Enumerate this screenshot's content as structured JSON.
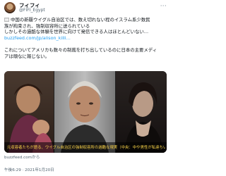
{
  "account": {
    "display_name": "フィフィ",
    "handle": "@FIFI_Egypt"
  },
  "tweet": {
    "line1": "中国の新疆ウイグル自治区では、数え切れない程のイスラム系少数民",
    "line2": "族が拘束され、強制収容所に送られている",
    "line3": "しかしその過酷な体験を世界に向けて発信できる人はほとんどいない…",
    "link": "buzzfeed.com/jp/alison_killi…",
    "line4": "これについてアメリカも数々の制裁を打ち出しているのに日本の主要メディ",
    "line5": "アは頑なに報じない。"
  },
  "media": {
    "caption": "元収容者たちが語る、ウイグル自治区の強制収容所の過酷な現実（中央：中や男性が私達ちいる…"
  },
  "card_source": "buzzfeed.comから",
  "timestamp": "午後6:29 · 2021年1月20日",
  "icons": {
    "more": "more-icon",
    "flag": "egypt-flag-icon",
    "avatar": "avatar-image"
  }
}
